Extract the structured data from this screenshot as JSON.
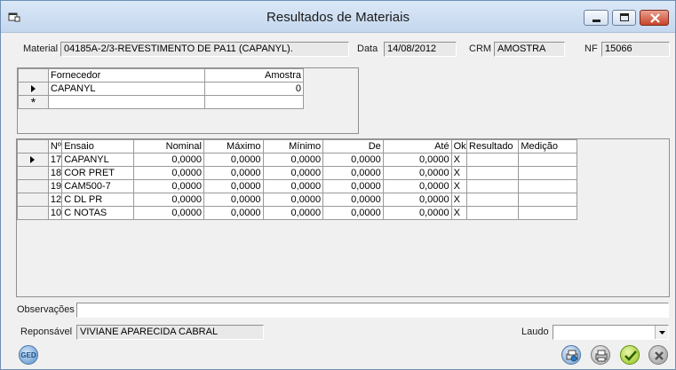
{
  "window": {
    "title": "Resultados de Materiais"
  },
  "header": {
    "material_label": "Material",
    "material_value": "04185A-2/3-REVESTIMENTO DE PA11 (CAPANYL).",
    "data_label": "Data",
    "data_value": "14/08/2012",
    "crm_label": "CRM",
    "crm_value": "AMOSTRA",
    "nf_label": "NF",
    "nf_value": "15066"
  },
  "supplier_grid": {
    "columns": [
      "Fornecedor",
      "Amostra"
    ],
    "rows": [
      {
        "fornecedor": "CAPANYL",
        "amostra": "0"
      }
    ],
    "new_row_marker": "*"
  },
  "tests_grid": {
    "columns": [
      "Nº",
      "Ensaio",
      "Nominal",
      "Máximo",
      "Mínimo",
      "De",
      "Até",
      "Ok",
      "Resultado",
      "Medição"
    ],
    "rows": [
      {
        "n": "17",
        "ensaio": "CAPANYL",
        "nominal": "0,0000",
        "maximo": "0,0000",
        "minimo": "0,0000",
        "de": "0,0000",
        "ate": "0,0000",
        "ok": "X",
        "resultado": "",
        "medicao": ""
      },
      {
        "n": "18",
        "ensaio": "COR PRET",
        "nominal": "0,0000",
        "maximo": "0,0000",
        "minimo": "0,0000",
        "de": "0,0000",
        "ate": "0,0000",
        "ok": "X",
        "resultado": "",
        "medicao": ""
      },
      {
        "n": "19",
        "ensaio": "CAM500-7",
        "nominal": "0,0000",
        "maximo": "0,0000",
        "minimo": "0,0000",
        "de": "0,0000",
        "ate": "0,0000",
        "ok": "X",
        "resultado": "",
        "medicao": ""
      },
      {
        "n": "12",
        "ensaio": "C DL PR",
        "nominal": "0,0000",
        "maximo": "0,0000",
        "minimo": "0,0000",
        "de": "0,0000",
        "ate": "0,0000",
        "ok": "X",
        "resultado": "",
        "medicao": ""
      },
      {
        "n": "10",
        "ensaio": "C NOTAS",
        "nominal": "0,0000",
        "maximo": "0,0000",
        "minimo": "0,0000",
        "de": "0,0000",
        "ate": "0,0000",
        "ok": "X",
        "resultado": "",
        "medicao": ""
      }
    ]
  },
  "footer": {
    "observacoes_label": "Observações",
    "observacoes_value": "",
    "responsavel_label": "Reponsável",
    "responsavel_value": "VIVIANE APARECIDA CABRAL",
    "laudo_label": "Laudo",
    "laudo_value": "",
    "ged_label": "GED"
  },
  "icons": [
    "app-icon",
    "minimize-icon",
    "maximize-icon",
    "close-icon",
    "ged-icon",
    "print-preview-icon",
    "print-icon",
    "confirm-icon",
    "cancel-icon"
  ]
}
